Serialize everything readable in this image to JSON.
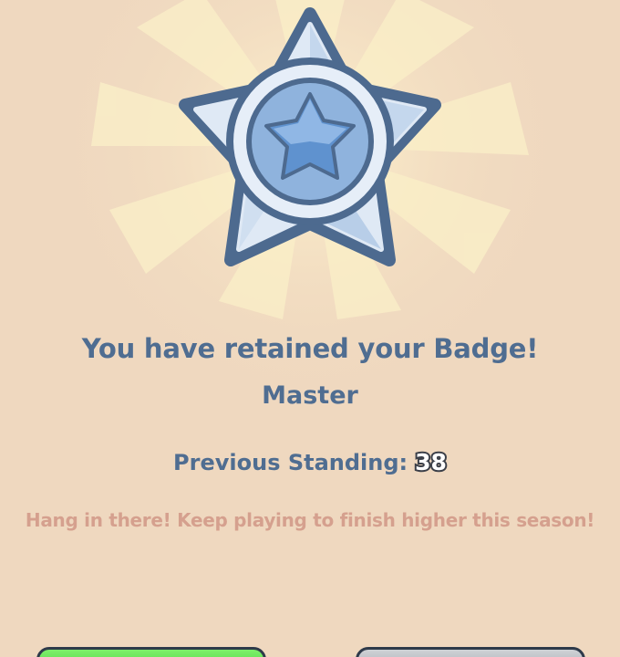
{
  "result": {
    "title": "You have retained your Badge!",
    "badge_name": "Master",
    "standing_label": "Previous Standing:",
    "standing_value": "38",
    "message": "Hang in there! Keep playing to finish higher this season!"
  },
  "badge": {
    "icon": "star-badge-icon",
    "colors": {
      "outline": "#4d6a8f",
      "light": "#dfe9f5",
      "mid": "#8fb3dd",
      "core": "#5f92cf"
    }
  },
  "buttons": {
    "primary_color": "#4fd64a",
    "secondary_color": "#b3b8be"
  },
  "colors": {
    "background": "#efd8bf",
    "title_text": "#4f6d91",
    "message_text": "#d5a08e"
  }
}
